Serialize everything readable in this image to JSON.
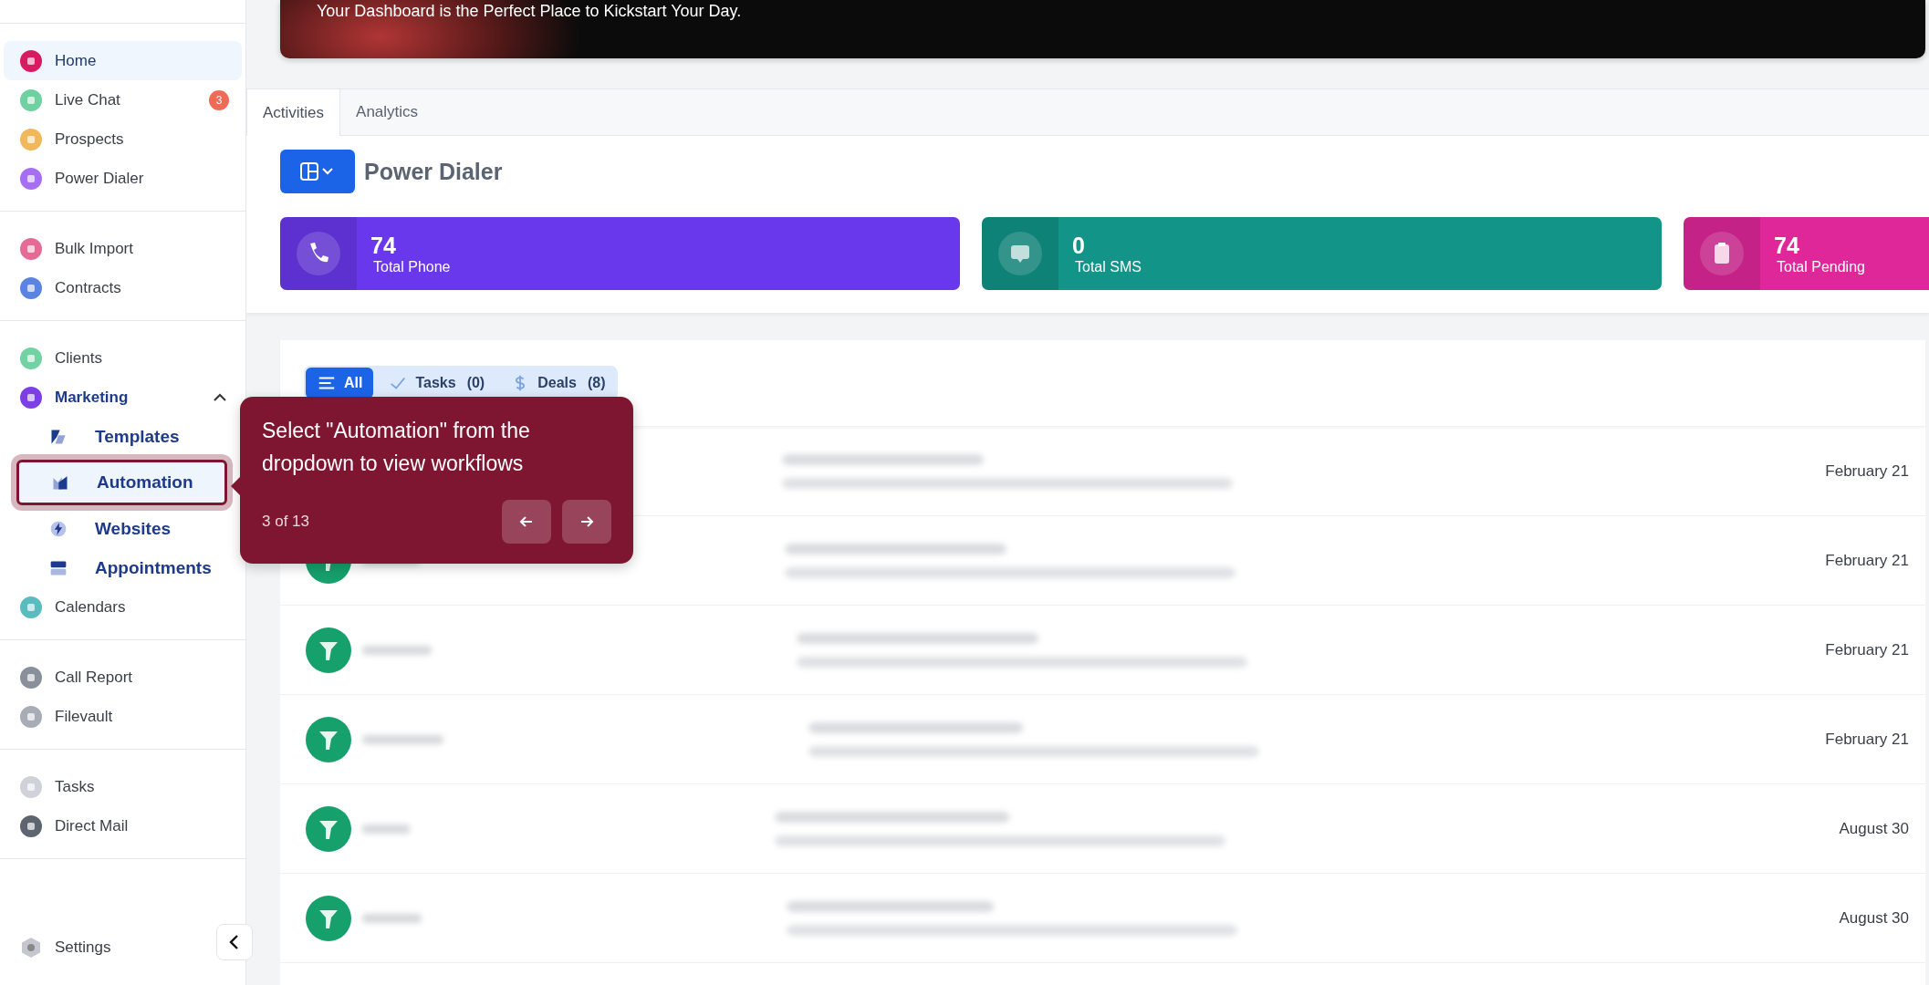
{
  "sidebar": {
    "groups": [
      [
        {
          "label": "Home",
          "color": "#d81b60",
          "selected": true
        },
        {
          "label": "Live Chat",
          "color": "#6fd0a0",
          "selected": false,
          "badge": "3"
        },
        {
          "label": "Prospects",
          "color": "#f0b85a",
          "selected": false
        },
        {
          "label": "Power Dialer",
          "color": "#a66ef0",
          "selected": false
        }
      ],
      [
        {
          "label": "Bulk Import",
          "color": "#e56b95",
          "selected": false
        },
        {
          "label": "Contracts",
          "color": "#5b83e0",
          "selected": false
        }
      ],
      [
        {
          "label": "Clients",
          "color": "#72d2a4",
          "selected": false
        },
        {
          "label": "Marketing",
          "color": "#7b3fe4",
          "selected": false,
          "expanded": true,
          "children": [
            {
              "label": "Templates",
              "highlighted": false
            },
            {
              "label": "Automation",
              "highlighted": true
            },
            {
              "label": "Websites",
              "highlighted": false
            },
            {
              "label": "Appointments",
              "highlighted": false
            }
          ]
        },
        {
          "label": "Calendars",
          "color": "#5bbcc0",
          "selected": false
        }
      ],
      [
        {
          "label": "Call Report",
          "color": "#8a9099",
          "selected": false
        },
        {
          "label": "Filevault",
          "color": "#a8adb5",
          "selected": false
        }
      ],
      [
        {
          "label": "Tasks",
          "color": "#cfd3d9",
          "selected": false
        },
        {
          "label": "Direct Mail",
          "color": "#5f6570",
          "selected": false
        }
      ]
    ],
    "footer": {
      "label": "Settings",
      "color": "#c4c8ce"
    }
  },
  "banner": {
    "text": "Your Dashboard is the Perfect Place to Kickstart Your Day."
  },
  "tabs": [
    {
      "label": "Activities",
      "selected": true
    },
    {
      "label": "Analytics",
      "selected": false
    }
  ],
  "section": {
    "title": "Power Dialer"
  },
  "stats": [
    {
      "value": "74",
      "label": "Total Phone",
      "color": "#6a38ec"
    },
    {
      "value": "0",
      "label": "Total SMS",
      "color": "#129488"
    },
    {
      "value": "74",
      "label": "Total Pending",
      "color": "#e0279a"
    }
  ],
  "filters": [
    {
      "label": "All",
      "selected": true
    },
    {
      "label": "Tasks",
      "count": "(0)",
      "selected": false
    },
    {
      "label": "Deals",
      "count": "(8)",
      "selected": false
    }
  ],
  "rows": [
    {
      "date": "February 21",
      "kind": "covered"
    },
    {
      "date": "February 21",
      "kind": "full"
    },
    {
      "date": "February 21",
      "kind": "full"
    },
    {
      "date": "February 21",
      "kind": "full"
    },
    {
      "date": "August 30",
      "kind": "full"
    },
    {
      "date": "August 30",
      "kind": "full"
    }
  ],
  "tour": {
    "text": "Select \"Automation\" from the dropdown to view workflows",
    "step": "3 of 13"
  }
}
